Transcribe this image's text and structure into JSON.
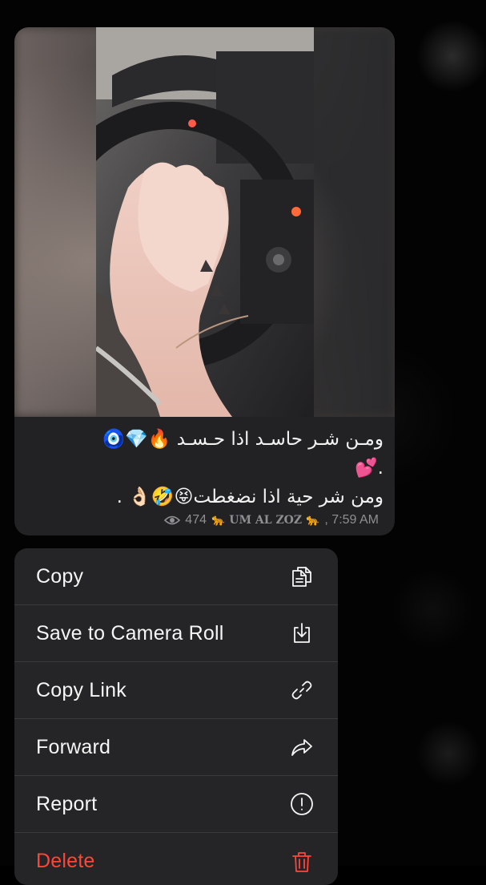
{
  "message": {
    "caption_lines": [
      "ومـن شـر حاسـد اذا حـسـد 🔥💎🧿",
      ".💕",
      "ومن شر حية اذا نضغطت😝🤣👌🏻 ."
    ],
    "views": "474",
    "channel_name": "🐆 UM AL ZOZ 🐆",
    "time": ", 7:59 AM"
  },
  "context_menu": {
    "items": [
      {
        "label": "Copy",
        "icon": "copy-icon"
      },
      {
        "label": "Save to Camera Roll",
        "icon": "save-download-icon"
      },
      {
        "label": "Copy Link",
        "icon": "link-icon"
      },
      {
        "label": "Forward",
        "icon": "forward-arrow-icon"
      },
      {
        "label": "Report",
        "icon": "report-exclamation-icon"
      },
      {
        "label": "Delete",
        "icon": "trash-icon"
      }
    ]
  },
  "colors": {
    "background": "#000000",
    "bubble": "#222224",
    "menu": "#252527",
    "meta_text": "#8e8e93",
    "destructive": "#ff453a"
  }
}
